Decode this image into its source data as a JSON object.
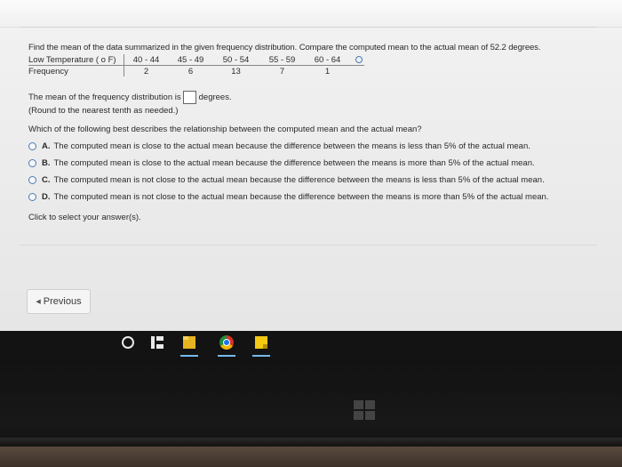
{
  "question": {
    "text": "Find the mean of the data summarized in the given frequency distribution. Compare the computed mean to the actual mean of 52.2 degrees."
  },
  "table": {
    "row1_label": "Low Temperature ( o F)",
    "row2_label": "Frequency",
    "ranges": [
      "40 - 44",
      "45 - 49",
      "50 - 54",
      "55 - 59",
      "60 - 64"
    ],
    "frequencies": [
      "2",
      "6",
      "13",
      "7",
      "1"
    ]
  },
  "answer": {
    "prefix": "The mean of the frequency distribution is",
    "suffix": "degrees.",
    "hint": "(Round to the nearest tenth as needed.)"
  },
  "mcq": {
    "question": "Which of the following best describes the relationship between the computed mean and the actual mean?",
    "options": [
      {
        "letter": "A.",
        "text": "The computed mean is close to the actual mean because the difference between the means is less than 5% of the actual mean."
      },
      {
        "letter": "B.",
        "text": "The computed mean is close to the actual mean because the difference between the means is more than 5% of the actual mean."
      },
      {
        "letter": "C.",
        "text": "The computed mean is not close to the actual mean because the difference between the means is less than 5% of the actual mean."
      },
      {
        "letter": "D.",
        "text": "The computed mean is not close to the actual mean because the difference between the means is more than 5% of the actual mean."
      }
    ]
  },
  "click_text": "Click to select your answer(s).",
  "nav": {
    "previous_label": "Previous"
  },
  "taskbar": {
    "icons": [
      "cortana-icon",
      "task-view-icon",
      "file-explorer-icon",
      "chrome-icon",
      "sticky-notes-icon"
    ]
  }
}
